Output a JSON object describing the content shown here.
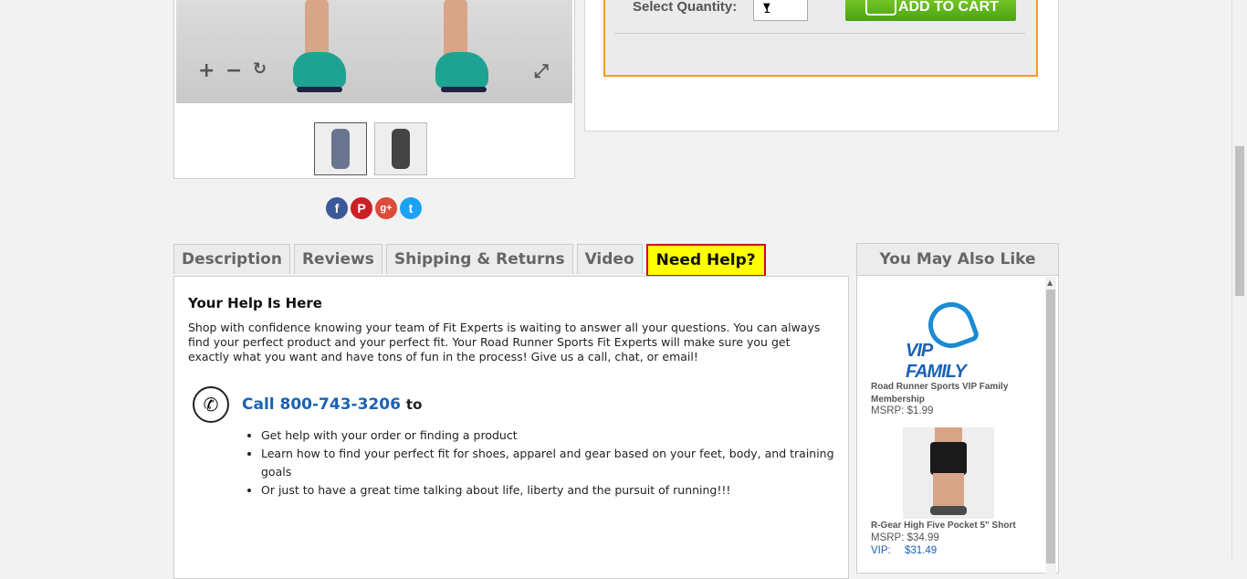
{
  "product_image": {
    "zoom_in_icon": "+",
    "zoom_out_icon": "−",
    "reset_icon": "↻",
    "fullscreen_icon": "⤢"
  },
  "social": {
    "facebook": "f",
    "pinterest": "P",
    "googleplus": "g+",
    "twitter": "t"
  },
  "purchase": {
    "quantity_label": "Select Quantity:",
    "quantity_value": "1",
    "add_to_cart_label": "ADD TO CART"
  },
  "tabs": [
    {
      "label": "Description"
    },
    {
      "label": "Reviews"
    },
    {
      "label": "Shipping & Returns"
    },
    {
      "label": "Video"
    },
    {
      "label": "Need Help?"
    }
  ],
  "help": {
    "title": "Your Help Is Here",
    "body": "Shop with confidence knowing your team of Fit Experts is waiting to answer all your questions. You can always find your perfect product and your perfect fit. Your Road Runner Sports Fit Experts will make sure you get exactly what you want and have tons of fun in the process! Give us a call, chat, or email!",
    "call_label": "Call 800-743-3206",
    "call_suffix": "to",
    "bullets": [
      "Get help with your order or finding a product",
      "Learn how to find your perfect fit for shoes, apparel and gear based on your feet, body, and training goals",
      "Or just to have a great time talking about life, liberty and the pursuit of running!!!"
    ]
  },
  "sidebar": {
    "title": "You May Also Like",
    "items": [
      {
        "logo_text": "VIP FAMILY",
        "name": "Road Runner Sports VIP Family Membership",
        "msrp_label": "MSRP:",
        "msrp": "$1.99"
      },
      {
        "name": "R-Gear High Five Pocket 5\" Short",
        "msrp_label": "MSRP:",
        "msrp": "$34.99",
        "vip_label": "VIP:",
        "vip": "$31.49"
      }
    ]
  },
  "colors": {
    "accent_blue": "#1a62b4",
    "help_tab_bg": "#ffff00",
    "help_tab_border": "#d8001e",
    "cart_green": "#4aa313",
    "buy_box_border": "#f39c1f"
  }
}
